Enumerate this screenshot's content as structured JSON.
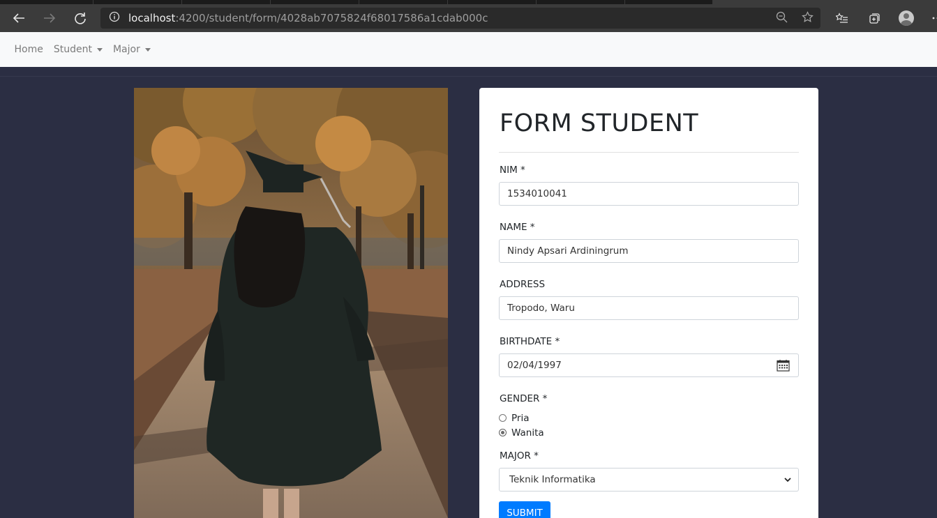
{
  "browser": {
    "url_host": "localhost",
    "url_path": ":4200/student/form/4028ab7075824f68017586a1cdab000c"
  },
  "navbar": {
    "items": [
      {
        "label": "Home",
        "dropdown": false
      },
      {
        "label": "Student",
        "dropdown": true
      },
      {
        "label": "Major",
        "dropdown": true
      }
    ]
  },
  "form": {
    "title": "FORM STUDENT",
    "nim": {
      "label": "NIM *",
      "value": "1534010041"
    },
    "name": {
      "label": "NAME *",
      "value": "Nindy Apsari Ardiningrum"
    },
    "address": {
      "label": "ADDRESS",
      "value": "Tropodo, Waru"
    },
    "birthdate": {
      "label": "BIRTHDATE *",
      "value": "02/04/1997"
    },
    "gender": {
      "label": "GENDER *",
      "options": [
        {
          "label": "Pria",
          "checked": false
        },
        {
          "label": "Wanita",
          "checked": true
        }
      ]
    },
    "major": {
      "label": "MAJOR *",
      "selected": "Teknik Informatika"
    },
    "submit_label": "SUBMIT"
  },
  "colors": {
    "page_bg": "#2b2e43",
    "primary": "#007bff",
    "navbar_bg": "#f8f9fa",
    "browser_toolbar": "#3b3b3b"
  }
}
